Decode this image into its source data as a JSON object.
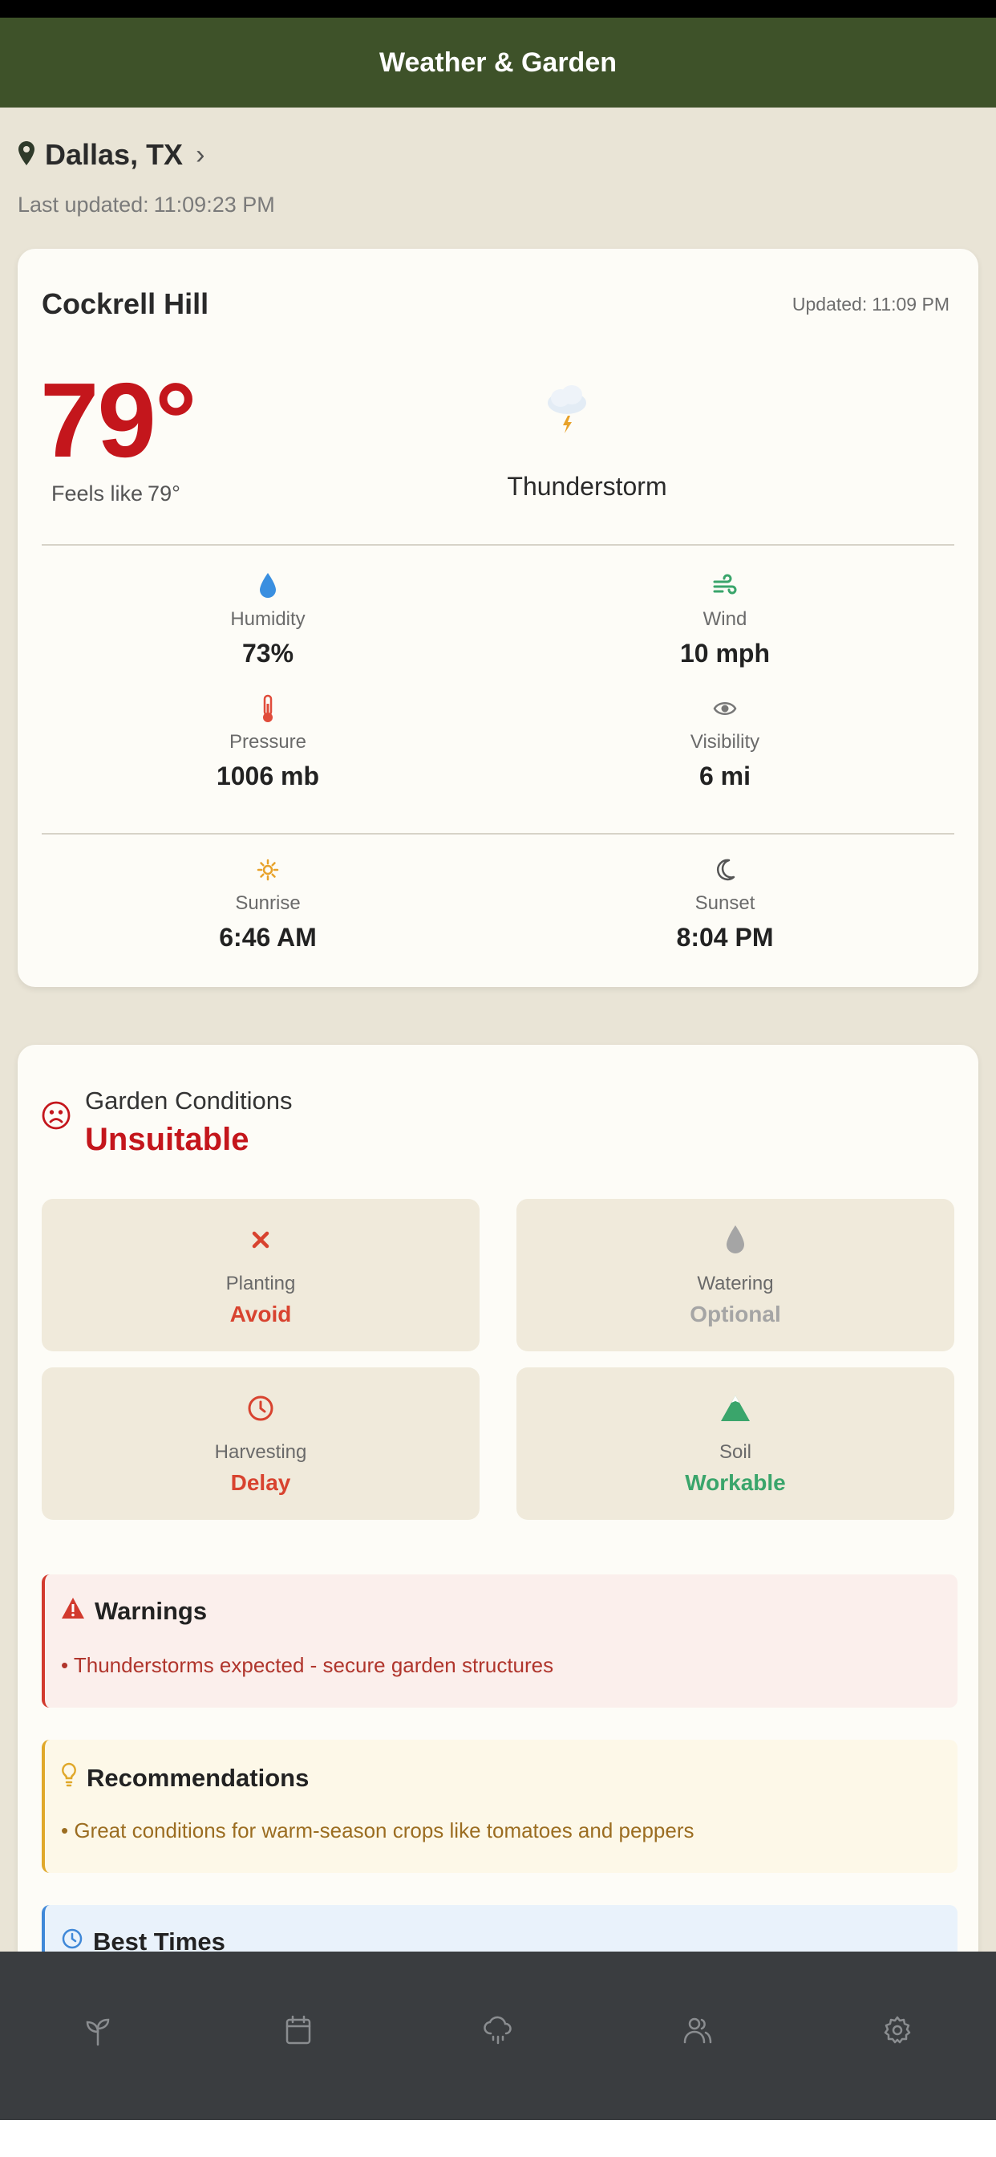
{
  "header": {
    "title": "Weather & Garden"
  },
  "location": {
    "name": "Dallas, TX",
    "last_updated_label": "Last updated:",
    "last_updated_time": "11:09:23 PM"
  },
  "weather": {
    "city": "Cockrell Hill",
    "updated_label": "Updated:",
    "updated_time": "11:09 PM",
    "temperature": "79°",
    "feels_like_label": "Feels like",
    "feels_like_value": "79°",
    "condition": "Thunderstorm",
    "stats": [
      {
        "label": "Humidity",
        "value": "73%",
        "icon": "water-drop-icon",
        "color": "#3a8fe0"
      },
      {
        "label": "Wind",
        "value": "10 mph",
        "icon": "wind-icon",
        "color": "#3aa56b"
      },
      {
        "label": "Pressure",
        "value": "1006 mb",
        "icon": "thermometer-icon",
        "color": "#e04c3b"
      },
      {
        "label": "Visibility",
        "value": "6 mi",
        "icon": "eye-icon",
        "color": "#777777"
      }
    ],
    "sun": [
      {
        "label": "Sunrise",
        "value": "6:46 AM",
        "icon": "sun-icon",
        "color": "#e8a22a"
      },
      {
        "label": "Sunset",
        "value": "8:04 PM",
        "icon": "moon-icon",
        "color": "#555555"
      }
    ]
  },
  "garden": {
    "title": "Garden Conditions",
    "status": "Unsuitable",
    "tiles": [
      {
        "label": "Planting",
        "value": "Avoid",
        "icon": "x-icon",
        "color": "#d8432f"
      },
      {
        "label": "Watering",
        "value": "Optional",
        "icon": "water-drop-icon",
        "color": "#a5a5a5"
      },
      {
        "label": "Harvesting",
        "value": "Delay",
        "icon": "clock-icon",
        "color": "#d8432f"
      },
      {
        "label": "Soil",
        "value": "Workable",
        "icon": "mountain-icon",
        "color": "#3aa56b"
      }
    ],
    "warnings": {
      "title": "Warnings",
      "items": [
        "Thunderstorms expected - secure garden structures"
      ]
    },
    "recommendations": {
      "title": "Recommendations",
      "items": [
        "Great conditions for warm-season crops like tomatoes and peppers"
      ]
    },
    "best_times": {
      "title": "Best Times"
    }
  },
  "tabbar": {
    "tabs": [
      {
        "icon": "sprout-icon"
      },
      {
        "icon": "calendar-icon"
      },
      {
        "icon": "rain-icon"
      },
      {
        "icon": "users-icon"
      },
      {
        "icon": "gear-icon"
      }
    ]
  },
  "colors": {
    "header": "#3e5229",
    "accent_red": "#c4161c",
    "background": "#e9e4d6",
    "tabbar": "#3a3d40"
  }
}
